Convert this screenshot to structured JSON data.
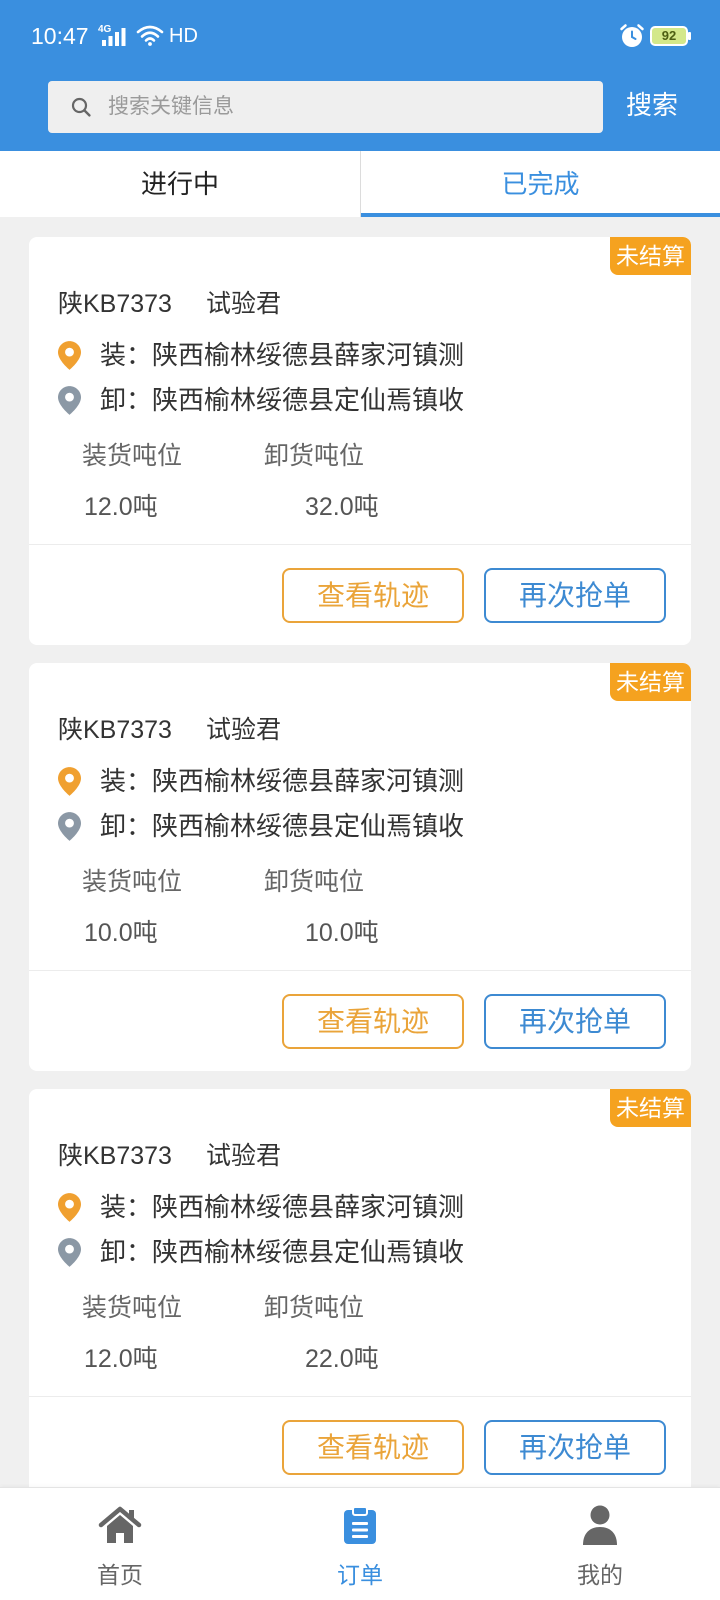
{
  "status_bar": {
    "time": "10:47",
    "network": "4G",
    "hd": "HD",
    "battery": "92"
  },
  "search": {
    "icon": "search-icon",
    "placeholder": "搜索关键信息",
    "value": "",
    "button_label": "搜索"
  },
  "tabs": [
    {
      "label": "进行中",
      "active": false
    },
    {
      "label": "已完成",
      "active": true
    }
  ],
  "order_labels": {
    "load_prefix": "装：",
    "unload_prefix": "卸：",
    "load_weight_label": "装货吨位",
    "unload_weight_label": "卸货吨位",
    "track_button": "查看轨迹",
    "regrab_button": "再次抢单"
  },
  "orders": [
    {
      "status": "未结算",
      "plate": "陕KB7373",
      "driver": "试验君",
      "load_address": "陕西榆林绥德县薛家河镇测",
      "unload_address": "陕西榆林绥德县定仙焉镇收",
      "load_weight": "12.0吨",
      "unload_weight": "32.0吨"
    },
    {
      "status": "未结算",
      "plate": "陕KB7373",
      "driver": "试验君",
      "load_address": "陕西榆林绥德县薛家河镇测",
      "unload_address": "陕西榆林绥德县定仙焉镇收",
      "load_weight": "10.0吨",
      "unload_weight": "10.0吨"
    },
    {
      "status": "未结算",
      "plate": "陕KB7373",
      "driver": "试验君",
      "load_address": "陕西榆林绥德县薛家河镇测",
      "unload_address": "陕西榆林绥德县定仙焉镇收",
      "load_weight": "12.0吨",
      "unload_weight": "22.0吨"
    }
  ],
  "bottom_nav": [
    {
      "label": "首页",
      "icon": "home-icon",
      "active": false
    },
    {
      "label": "订单",
      "icon": "clipboard-icon",
      "active": true
    },
    {
      "label": "我的",
      "icon": "person-icon",
      "active": false
    }
  ],
  "colors": {
    "primary": "#3a8fdf",
    "badge": "#f5a21f",
    "btn_orange": "#eaa43a",
    "btn_blue": "#3d8ad2",
    "pin_orange": "#f0a030",
    "pin_grey": "#8b98a5",
    "page_bg": "#f0f0f0",
    "nav_grey": "#666666"
  }
}
